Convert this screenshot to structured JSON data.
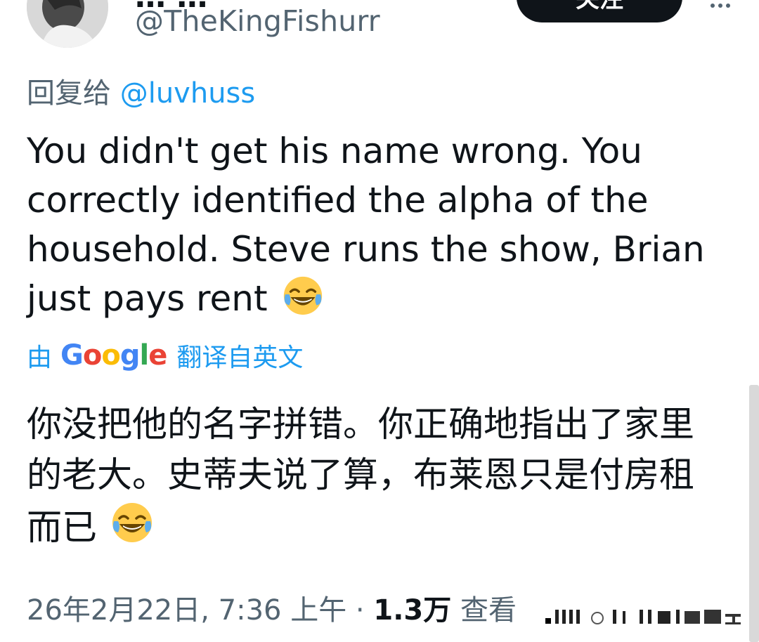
{
  "tweet": {
    "display_name_peek": "… …",
    "handle": "@TheKingFishurr",
    "follow_label": "关注",
    "reply_prefix": "回复给",
    "reply_mention": "@luvhuss",
    "text": "You didn't get his name wrong. You correctly identified the alpha of the household. Steve runs the show, Brian just pays rent",
    "translation": {
      "by_label": "由",
      "provider_letters": [
        "G",
        "o",
        "o",
        "g",
        "l",
        "e"
      ],
      "source_label": "翻译自英文",
      "text": "你没把他的名字拼错。你正确地指出了家里的老大。史蒂夫说了算，布莱恩只是付房租而已"
    },
    "timestamp": "26年2月22日, 7:36 上午",
    "separator": " · ",
    "views_count": "1.3万",
    "views_label": " 查看"
  },
  "icons": {
    "avatar": "profile-photo",
    "more": "more-dots-icon",
    "emoji": "face-with-tears-of-joy-icon"
  },
  "colors": {
    "text_primary": "#0f1419",
    "text_secondary": "#536471",
    "link": "#1d9bf0",
    "follow_bg": "#0f1419"
  }
}
